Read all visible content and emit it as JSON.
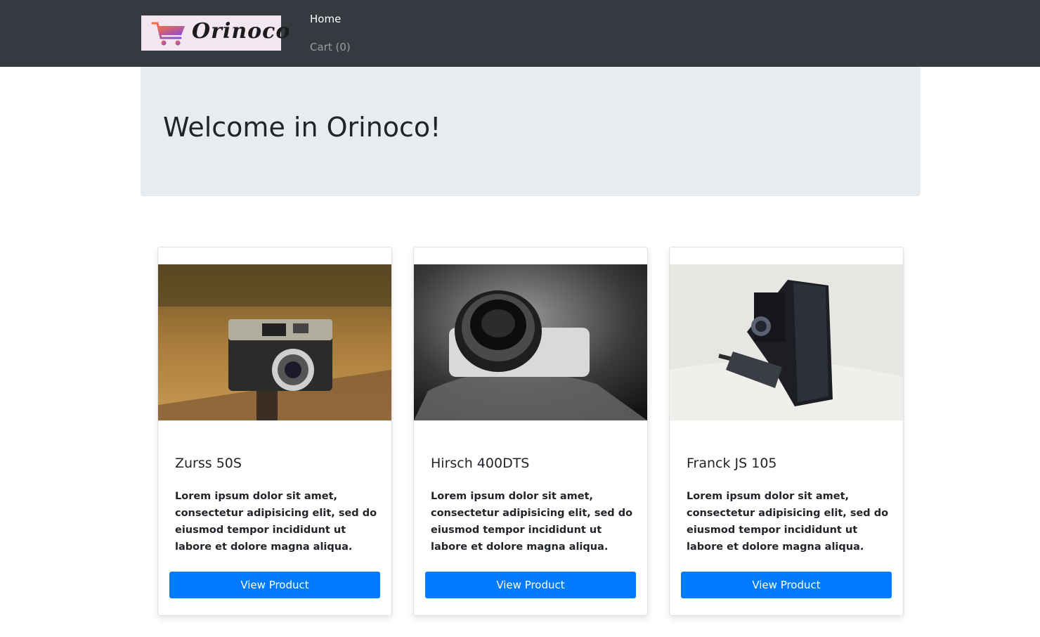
{
  "header": {
    "logo_text": "Orinoco",
    "nav": {
      "home_label": "Home",
      "cart_label": "Cart (0)"
    }
  },
  "hero": {
    "title": "Welcome in Orinoco!"
  },
  "products": [
    {
      "name": "Zurss 50S",
      "description": "Lorem ipsum dolor sit amet, consectetur adipisicing elit, sed do eiusmod tempor incididunt ut labore et dolore magna aliqua.",
      "button_label": "View Product",
      "image": "vintage-rangefinder-camera-photo"
    },
    {
      "name": "Hirsch 400DTS",
      "description": "Lorem ipsum dolor sit amet, consectetur adipisicing elit, sed do eiusmod tempor incididunt ut labore et dolore magna aliqua.",
      "button_label": "View Product",
      "image": "black-and-white-lens-photo"
    },
    {
      "name": "Franck JS 105",
      "description": "Lorem ipsum dolor sit amet, consectetur adipisicing elit, sed do eiusmod tempor incididunt ut labore et dolore magna aliqua.",
      "button_label": "View Product",
      "image": "folding-bellows-camera-photo"
    }
  ],
  "colors": {
    "navbar": "#343a40",
    "jumbotron": "#e9ecef",
    "primary_button": "#007bff"
  }
}
